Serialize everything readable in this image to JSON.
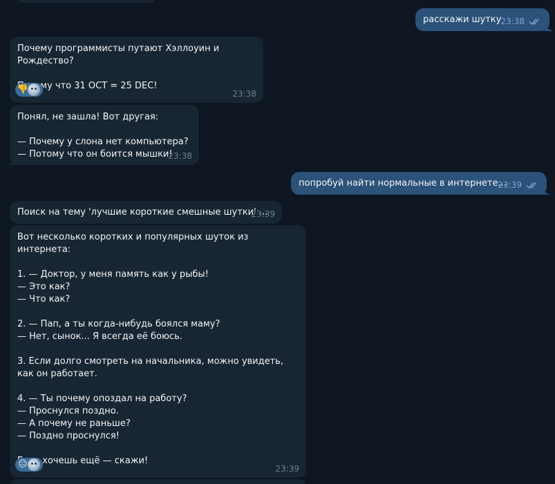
{
  "messages": [
    {
      "id": "m1",
      "dir": "out",
      "text": "расскажи шутку",
      "time": "23:38"
    },
    {
      "id": "m2",
      "dir": "in",
      "text": "Почему программисты путают Хэллоуин и Рождество?\n\nПотому что 31 OCT = 25 DEC!",
      "time": "23:38",
      "reaction": "👎"
    },
    {
      "id": "m3",
      "dir": "in",
      "text": "Понял, не зашла! Вот другая:\n\n— Почему у слона нет компьютера?\n— Потому что он боится мышки!",
      "time": "23:38"
    },
    {
      "id": "m4",
      "dir": "out",
      "text": "попробуй найти нормальные в интернете...",
      "time": "23:39"
    },
    {
      "id": "m5",
      "dir": "in",
      "text": "Поиск на тему 'лучшие короткие смешные шутки' ...",
      "time": "23:39"
    },
    {
      "id": "m6",
      "dir": "in",
      "text": "Вот несколько коротких и популярных шуток из интернета:\n\n1. — Доктор, у меня память как у рыбы!\n— Это как?\n— Что как?\n\n2. — Пап, а ты когда-нибудь боялся маму?\n— Нет, сынок... Я всегда её боюсь.\n\n3. Если долго смотреть на начальника, можно увидеть, как он работает.\n\n4. — Ты почему опоздал на работу?\n— Проснулся поздно.\n— А почему не раньше?\n— Поздно проснулся!\n\nЕсли хочешь ещё — скажи!",
      "time": "23:39",
      "reaction": "😐"
    }
  ],
  "colors": {
    "background": "#0e1621",
    "incoming_bubble": "#182533",
    "outgoing_bubble": "#2b5278",
    "time_in": "#6d7f8f",
    "time_out": "#7da8d3",
    "read_checks": "#7da8d3"
  },
  "icons": {
    "read_status": "double-check-icon",
    "reactor_avatar": "avatar"
  }
}
